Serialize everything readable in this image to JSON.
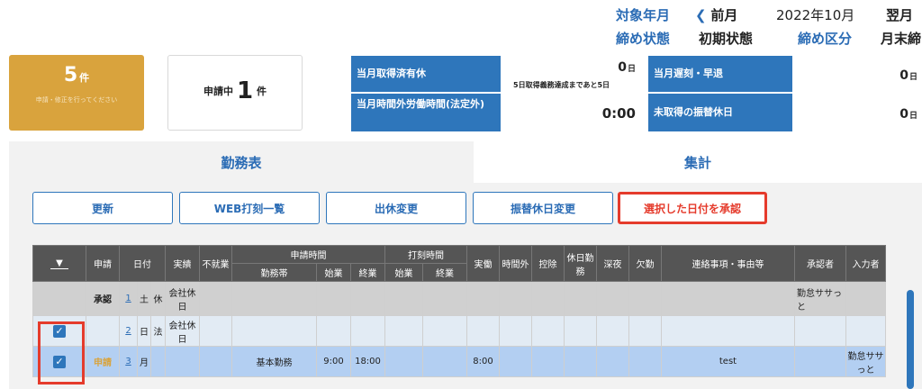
{
  "header": {
    "target_label": "対象年月",
    "prev_label": "前月",
    "month_value": "2022年10月",
    "next_label": "翌月",
    "close_status_label": "締め状態",
    "close_status_value": "初期状態",
    "close_category_label": "締め区分",
    "close_category_value": "月末締"
  },
  "cards": {
    "pending_count": "5",
    "pending_unit": "件",
    "pending_note": "申請・修正を行ってください",
    "applying_label": "申請中",
    "applying_count": "1",
    "applying_unit": "件"
  },
  "stats": {
    "paid_leave_label": "当月取得済有休",
    "paid_leave_value": "0",
    "paid_leave_unit": "日",
    "paid_leave_note": "5日取得義務達成まであと5日",
    "late_label": "当月遅刻・早退",
    "late_value": "0",
    "late_unit": "日",
    "overtime_label": "当月時間外労働時間(法定外)",
    "overtime_value": "0:00",
    "comp_label": "未取得の振替休日",
    "comp_value": "0",
    "comp_unit": "日"
  },
  "tabs": [
    "勤務表",
    "集計"
  ],
  "buttons": [
    "更新",
    "WEB打刻一覧",
    "出休変更",
    "振替休日変更",
    "選択した日付を承認"
  ],
  "table": {
    "head": {
      "check": "▼",
      "apply": "申請",
      "date": "日付",
      "actual": "実績",
      "nonwork": "不就業",
      "request_time": "申請時間",
      "stamp_time": "打刻時間",
      "worked": "実働",
      "overtime": "時間外",
      "deduct": "控除",
      "holiday_work": "休日勤務",
      "night": "深夜",
      "absence": "欠勤",
      "notes": "連絡事項・事由等",
      "approver": "承認者",
      "inputter": "入力者",
      "shift": "勤務帯",
      "start": "始業",
      "end": "終業",
      "stamp_start": "始業",
      "stamp_end": "終業"
    },
    "rows": [
      {
        "checked": false,
        "apply": "承認",
        "day": "1",
        "weekday": "土",
        "kind": "休",
        "actual": "会社休日",
        "shift": "",
        "start": "",
        "end": "",
        "worked": "",
        "notes": "",
        "approver": "勤怠ササっと",
        "inputter": ""
      },
      {
        "checked": true,
        "apply": "",
        "day": "2",
        "weekday": "日",
        "kind": "法",
        "actual": "会社休日",
        "shift": "",
        "start": "",
        "end": "",
        "worked": "",
        "notes": "",
        "approver": "",
        "inputter": ""
      },
      {
        "checked": true,
        "apply": "申請",
        "day": "3",
        "weekday": "月",
        "kind": "",
        "actual": "",
        "shift": "基本勤務",
        "start": "9:00",
        "end": "18:00",
        "worked": "8:00",
        "notes": "test",
        "approver": "",
        "inputter": "勤怠ササっと"
      }
    ]
  },
  "check_mark": "✓"
}
